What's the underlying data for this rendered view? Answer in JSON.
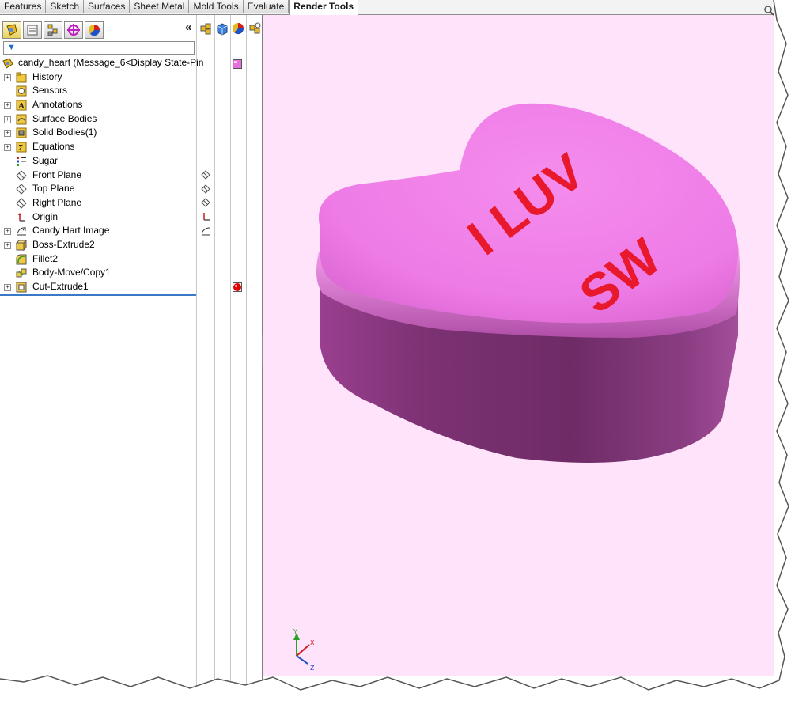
{
  "tabs": [
    {
      "label": "Features",
      "active": false
    },
    {
      "label": "Sketch",
      "active": false
    },
    {
      "label": "Surfaces",
      "active": false
    },
    {
      "label": "Sheet Metal",
      "active": false
    },
    {
      "label": "Mold Tools",
      "active": false
    },
    {
      "label": "Evaluate",
      "active": false
    },
    {
      "label": "Render Tools",
      "active": true
    }
  ],
  "panel": {
    "tab_icons": [
      "feature-manager-icon",
      "property-manager-icon",
      "configuration-manager-icon",
      "dimxpert-icon",
      "display-manager-icon"
    ],
    "collapse_glyph": "«",
    "toolbar_icons": [
      "hide-show-icon",
      "view-orientation-icon",
      "appearance-icon",
      "scene-icon"
    ],
    "filter_icon": "filter-icon"
  },
  "tree": {
    "root": {
      "label": "candy_heart  (Message_6<Display State-Pin",
      "icon": "part-icon",
      "color_swatch": "#e86ee0"
    },
    "items": [
      {
        "label": "History",
        "icon": "history-folder-icon",
        "expandable": true
      },
      {
        "label": "Sensors",
        "icon": "sensor-icon",
        "expandable": false
      },
      {
        "label": "Annotations",
        "icon": "annotations-icon",
        "expandable": true
      },
      {
        "label": "Surface Bodies",
        "icon": "surface-bodies-icon",
        "expandable": true
      },
      {
        "label": "Solid Bodies(1)",
        "icon": "solid-bodies-icon",
        "expandable": true
      },
      {
        "label": "Equations",
        "icon": "equations-icon",
        "expandable": true
      },
      {
        "label": "Sugar",
        "icon": "material-icon",
        "expandable": false
      },
      {
        "label": "Front Plane",
        "icon": "plane-icon",
        "expandable": false
      },
      {
        "label": "Top Plane",
        "icon": "plane-icon",
        "expandable": false
      },
      {
        "label": "Right Plane",
        "icon": "plane-icon",
        "expandable": false
      },
      {
        "label": "Origin",
        "icon": "origin-icon",
        "expandable": false
      },
      {
        "label": "Candy Hart Image",
        "icon": "sketch-picture-icon",
        "expandable": true
      },
      {
        "label": "Boss-Extrude2",
        "icon": "boss-extrude-icon",
        "expandable": true
      },
      {
        "label": "Fillet2",
        "icon": "fillet-icon",
        "expandable": false
      },
      {
        "label": "Body-Move/Copy1",
        "icon": "move-copy-icon",
        "expandable": false
      },
      {
        "label": "Cut-Extrude1",
        "icon": "cut-extrude-icon",
        "expandable": true
      }
    ],
    "cut_swatch_color": "#e00000"
  },
  "viewport": {
    "model_text_line1": "I LUV",
    "model_text_line2": "SW",
    "text_color": "#e8192c",
    "top_color": "#f07de8",
    "side_color": "#8a3a80",
    "background": "#ffe3fb",
    "triad": {
      "x_label": "X",
      "y_label": "Y",
      "z_label": "Z"
    }
  }
}
